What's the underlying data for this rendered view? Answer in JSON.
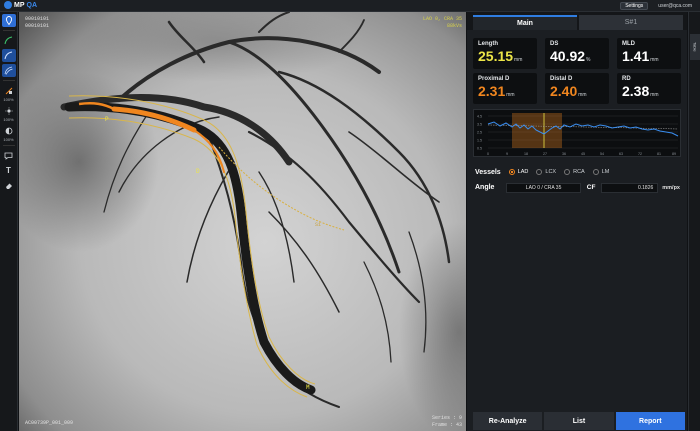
{
  "app": {
    "logo_a": "MP",
    "logo_b": "QA",
    "settings_label": "Settings",
    "user": "user@qca.com"
  },
  "toolbar": {
    "pct1": "100%",
    "pct2": "100%",
    "pct3": "100%"
  },
  "viewer": {
    "top_left_line1": "00010101",
    "top_left_line2": "00010101",
    "top_right_line1": "LAO 0, CRA 35",
    "top_right_line2": "88kVs",
    "bottom_left": "AC00739P_001_009",
    "bottom_right_line1": "Series : 9",
    "bottom_right_line2": "Frame : 43",
    "markers": {
      "p": "P",
      "d": "D",
      "m": "M"
    },
    "side_label": "S1"
  },
  "panel": {
    "tabs": [
      {
        "label": "Main"
      },
      {
        "label": "S#1"
      }
    ],
    "metrics": [
      {
        "label": "Length",
        "value": "25.15",
        "unit": "mm",
        "color": "#ece648"
      },
      {
        "label": "DS",
        "value": "40.92",
        "unit": "%",
        "color": "#ffffff"
      },
      {
        "label": "MLD",
        "value": "1.41",
        "unit": "mm",
        "color": "#ffffff"
      },
      {
        "label": "Proximal D",
        "value": "2.31",
        "unit": "mm",
        "color": "#f0861f"
      },
      {
        "label": "Distal D",
        "value": "2.40",
        "unit": "mm",
        "color": "#f0861f"
      },
      {
        "label": "RD",
        "value": "2.38",
        "unit": "mm",
        "color": "#ffffff"
      }
    ],
    "profile": {
      "y_ticks": [
        "4.5",
        "3.5",
        "2.5",
        "1.5",
        "0.5"
      ],
      "x_ticks": [
        "0",
        "9",
        "18",
        "27",
        "36",
        "45",
        "54",
        "63",
        "72",
        "81",
        "89"
      ]
    },
    "vessels": {
      "title": "Vessels",
      "options": [
        "LAD",
        "LCX",
        "RCA",
        "LM"
      ],
      "selected": "LAD"
    },
    "angle": {
      "label": "Angle",
      "value": "LAO 0 / CRA 35",
      "cf_label": "CF",
      "cf_value": "0.1826",
      "cf_unit": "mm/px"
    },
    "buttons": {
      "reanalyze": "Re-Analyze",
      "list": "List",
      "report": "Report"
    }
  },
  "rightstrip": {
    "tab_label": "Table"
  }
}
